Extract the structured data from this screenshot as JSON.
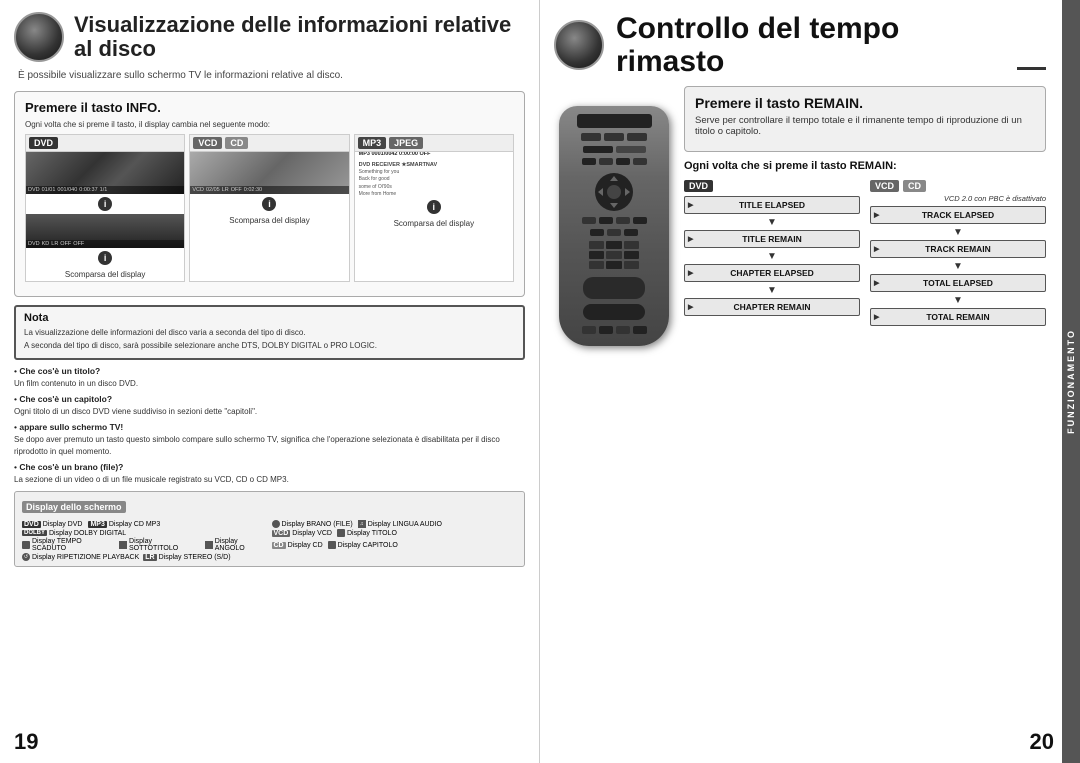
{
  "left_page": {
    "page_number": "19",
    "header": {
      "title": "Visualizzazione delle informazioni relative al disco",
      "subtitle": "È possibile visualizzare sullo schermo TV le informazioni relative al disco."
    },
    "section_info": {
      "title": "Premere il tasto INFO.",
      "bullet": "Ogni volta che si preme il tasto, il display cambia nel seguente modo:"
    },
    "formats": {
      "col1": {
        "badges": [
          "DVD"
        ],
        "label1": "Scomparsa del display"
      },
      "col2": {
        "badges": [
          "VCD",
          "CD"
        ],
        "label1": "Scomparsa del display"
      },
      "col3": {
        "badges": [
          "MP3",
          "JPEG"
        ],
        "label1": "Scomparsa del display"
      }
    },
    "nota": {
      "title": "Nota",
      "items": [
        "La visualizzazione delle informazioni del disco varia a seconda del tipo di disco.",
        "A seconda del tipo di disco, sarà possibile selezionare anche DTS, DOLBY DIGITAL o PRO LOGIC."
      ]
    },
    "bullets": [
      {
        "title": "Che cos'è un titolo?",
        "text": "Un film contenuto in un disco DVD."
      },
      {
        "title": "Che cos'è un capitolo?",
        "text": "Ogni titolo di un disco DVD viene suddiviso in sezioni dette \"capitoli\"."
      },
      {
        "title": "appare sullo schermo TV!",
        "text": "Se dopo aver premuto un tasto questo simbolo compare sullo schermo TV, significa che l'operazione selezionata è disabilitata per il disco riprodotto in quel momento."
      },
      {
        "title": "Che cos'è un brano (file)?",
        "text": "La sezione di un video o di un file musicale registrato su VCD, CD o CD MP3."
      }
    ],
    "display_schermo": {
      "title": "Display dello schermo",
      "items": [
        {
          "badge": "DVD",
          "text": "Display DVD"
        },
        {
          "badge": "MP3",
          "text": "Display CD MP3"
        },
        {
          "icon": "disc",
          "text": "Display BRANO (FILE)"
        },
        {
          "icon": "audio",
          "text": "Display LINGUA AUDIO"
        },
        {
          "icon": "dolby",
          "text": "Display DOLBY DIGITAL"
        },
        {
          "badge": "VCD",
          "text": "Display VCD"
        },
        {
          "icon": "title",
          "text": "Display TITOLO"
        },
        {
          "icon": "tempo",
          "text": "Display TEMPO SCADUTO"
        },
        {
          "icon": "sub",
          "text": "Display SOTTOTITOLO"
        },
        {
          "icon": "angle",
          "text": "Display ANGOLO"
        },
        {
          "badge": "CD",
          "text": "Display CD"
        },
        {
          "icon": "chapter",
          "text": "Display CAPITOLO"
        },
        {
          "icon": "repeat",
          "text": "Display RIPETIZIONE PLAYBACK"
        },
        {
          "badge": "LR",
          "text": "Display STEREO (S/D)"
        }
      ]
    }
  },
  "right_page": {
    "page_number": "20",
    "header": {
      "title": "Controllo del tempo rimasto"
    },
    "section_remain": {
      "title": "Premere il tasto REMAIN.",
      "subtitle": "Serve per controllare il tempo totale e il rimanente tempo di riproduzione di un titolo o capitolo.",
      "question": "Ogni volta che si preme il tasto REMAIN:"
    },
    "dvd_flow": {
      "label": "DVD",
      "items": [
        "TITLE ELAPSED",
        "TITLE REMAIN",
        "CHAPTER ELAPSED",
        "CHAPTER REMAIN"
      ]
    },
    "vcd_cd_flow": {
      "label": "VCD",
      "label2": "CD",
      "note": "VCD 2.0 con PBC è disattivato",
      "items": [
        "TRACK ELAPSED",
        "TRACK REMAIN",
        "TOTAL ELAPSED",
        "TOTAL REMAIN"
      ]
    },
    "sidebar": "FUNZIONAMENTO"
  }
}
